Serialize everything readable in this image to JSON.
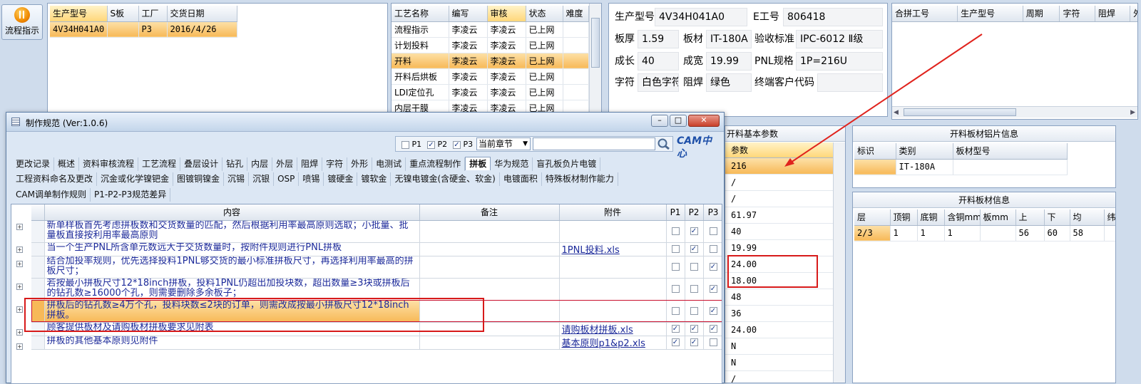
{
  "toolbar": {
    "flow_label": "流程指示"
  },
  "order_table": {
    "headers": [
      "生产型号",
      "S板",
      "工厂",
      "交货日期"
    ],
    "rows": [
      [
        "4V34H041A0",
        "",
        "P3",
        "2016/4/26"
      ]
    ]
  },
  "process_table": {
    "headers": [
      "工艺名称",
      "编写",
      "审核",
      "状态",
      "难度"
    ],
    "rows": [
      [
        "流程指示",
        "李凌云",
        "李凌云",
        "已上网",
        ""
      ],
      [
        "计划投料",
        "李凌云",
        "李凌云",
        "已上网",
        ""
      ],
      [
        "开料",
        "李凌云",
        "李凌云",
        "已上网",
        ""
      ],
      [
        "开料后烘板",
        "李凌云",
        "李凌云",
        "已上网",
        ""
      ],
      [
        "LDI定位孔",
        "李凌云",
        "李凌云",
        "已上网",
        ""
      ],
      [
        "内层干膜",
        "李凌云",
        "李凌云",
        "已上网",
        ""
      ]
    ]
  },
  "info": {
    "fields": [
      {
        "label": "生产型号",
        "value": "4V34H041A0"
      },
      {
        "label": "E工号",
        "value": "806418"
      },
      {
        "label": "板厚",
        "value": "1.59"
      },
      {
        "label": "板材",
        "value": "IT-180A"
      },
      {
        "label": "验收标准",
        "value": "IPC-6012 Ⅱ级"
      },
      {
        "label": "成长",
        "value": "40"
      },
      {
        "label": "成宽",
        "value": "19.99"
      },
      {
        "label": "PNL规格",
        "value": "1P=216U"
      },
      {
        "label": "字符",
        "value": "白色字符"
      },
      {
        "label": "阻焊",
        "value": "绿色"
      },
      {
        "label": "终端客户代码",
        "value": ""
      }
    ]
  },
  "merge_table": {
    "headers": [
      "合拼工号",
      "生产型号",
      "周期",
      "字符",
      "阻焊",
      "外层"
    ]
  },
  "basic_params": {
    "title": "开料基本参数",
    "header": "参数",
    "values": [
      "216",
      "/",
      "/",
      "61.97",
      "40",
      "19.99",
      "24.00",
      "18.00",
      "48",
      "36",
      "24.00",
      "N",
      "N",
      "/"
    ]
  },
  "al_panel": {
    "title": "开料板材铝片信息",
    "headers": [
      "标识",
      "类别",
      "板材型号"
    ],
    "rows": [
      [
        "",
        "IT-180A",
        ""
      ]
    ]
  },
  "sheet_panel": {
    "title": "开料板材信息",
    "headers": [
      "层",
      "顶铜",
      "底铜",
      "含铜mm",
      "板mm",
      "上",
      "下",
      "均",
      "纬"
    ],
    "rows": [
      [
        "2/3",
        "1",
        "1",
        "1",
        "",
        "56",
        "60",
        "58",
        ""
      ]
    ]
  },
  "dialog": {
    "title": "制作规范 (Ver:1.0.6)",
    "filters": [
      {
        "label": "P1",
        "checked": false
      },
      {
        "label": "P2",
        "checked": true
      },
      {
        "label": "P3",
        "checked": true
      }
    ],
    "chapter_select": "当前章节",
    "search_value": "",
    "logo": "CAM中心",
    "tabs_row1": [
      "更改记录",
      "概述",
      "资料审核流程",
      "工艺流程",
      "叠层设计",
      "钻孔",
      "内层",
      "外层",
      "阻焊",
      "字符",
      "外形",
      "电测试",
      "重点流程制作",
      "拼板",
      "华为规范",
      "盲孔板负片电镀"
    ],
    "tabs_row2": [
      "工程资料命名及更改",
      "沉金或化学镍钯金",
      "图镀铜镍金",
      "沉锡",
      "沉银",
      "OSP",
      "喷锡",
      "镀硬金",
      "镀软金",
      "无镍电镀金(含硬金、软金)",
      "电镀面积",
      "特殊板材制作能力"
    ],
    "tabs_row3": [
      "CAM调单制作规则",
      "P1-P2-P3规范差异"
    ],
    "active_tab": "拼板",
    "table_headers": [
      "内容",
      "备注",
      "附件",
      "P1",
      "P2",
      "P3"
    ],
    "rows": [
      {
        "content": "新单样板首先考虑拼板数和交货数量的匹配，然后根据利用率最高原则选取；小批量、批量板直接按利用率最高原则",
        "note": "",
        "attach": "",
        "p1": false,
        "p2": true,
        "p3": false
      },
      {
        "content": "当一个生产PNL所含单元数远大于交货数量时，按附件规则进行PNL拼板",
        "note": "",
        "attach": "1PNL投料.xls",
        "p1": false,
        "p2": true,
        "p3": false
      },
      {
        "content": "结合加投率规则，优先选择投料1PNL够交货的最小标准拼板尺寸，再选择利用率最高的拼板尺寸；",
        "note": "",
        "attach": "",
        "p1": false,
        "p2": false,
        "p3": true
      },
      {
        "content": "若按最小拼板尺寸12*18inch拼板，投料1PNL仍超出加投块数，超出数量≥3块或拼板后的钻孔数≥16000个孔，则需要删除多余板子；",
        "note": "",
        "attach": "",
        "p1": false,
        "p2": false,
        "p3": true
      },
      {
        "content": "拼板后的钻孔数≥4万个孔，投料块数≤2块的订单，则需改成按最小拼板尺寸12*18inch拼板。",
        "note": "",
        "attach": "",
        "p1": false,
        "p2": false,
        "p3": true
      },
      {
        "content": "顾客提供板材及请购板材拼板要求见附表",
        "note": "",
        "attach": "请购板材拼板.xls",
        "p1": true,
        "p2": true,
        "p3": true
      },
      {
        "content": "拼板的其他基本原则见附件",
        "note": "",
        "attach": "基本原则p1&p2.xls",
        "p1": true,
        "p2": true,
        "p3": false
      }
    ]
  }
}
